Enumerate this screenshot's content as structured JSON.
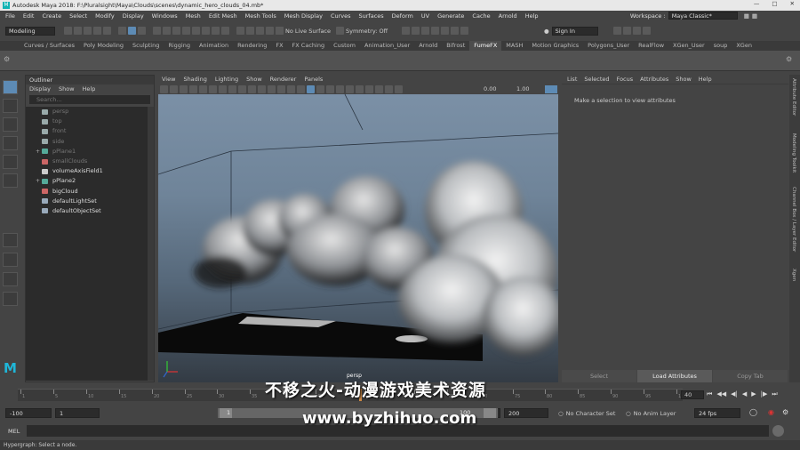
{
  "title_bar": {
    "text": "Autodesk Maya 2018: F:\\Pluralsight\\Maya\\Clouds\\scenes\\dynamic_hero_clouds_04.mb*"
  },
  "menu_bar": {
    "items": [
      "File",
      "Edit",
      "Create",
      "Select",
      "Modify",
      "Display",
      "Windows",
      "Mesh",
      "Edit Mesh",
      "Mesh Tools",
      "Mesh Display",
      "Curves",
      "Surfaces",
      "Deform",
      "UV",
      "Generate",
      "Cache",
      "Arnold",
      "Help"
    ],
    "workspace_label": "Workspace :",
    "workspace_value": "Maya Classic*"
  },
  "status_line": {
    "mode": "Modeling",
    "live_surface": "No Live Surface",
    "symmetry": "Symmetry: Off",
    "sign_in": "Sign In"
  },
  "shelf": {
    "tabs": [
      "Curves / Surfaces",
      "Poly Modeling",
      "Sculpting",
      "Rigging",
      "Animation",
      "Rendering",
      "FX",
      "FX Caching",
      "Custom",
      "Animation_User",
      "Arnold",
      "Bifrost",
      "FumeFX",
      "MASH",
      "Motion Graphics",
      "Polygons_User",
      "RealFlow",
      "XGen_User",
      "soup",
      "XGen"
    ],
    "active_tab": "FumeFX"
  },
  "outliner": {
    "title": "Outliner",
    "menu": [
      "Display",
      "Show",
      "Help"
    ],
    "search_placeholder": "Search...",
    "items": [
      {
        "label": "persp",
        "kind": "camera",
        "dim": true,
        "expandable": false
      },
      {
        "label": "top",
        "kind": "camera",
        "dim": true,
        "expandable": false
      },
      {
        "label": "front",
        "kind": "camera",
        "dim": true,
        "expandable": false
      },
      {
        "label": "side",
        "kind": "camera",
        "dim": true,
        "expandable": false
      },
      {
        "label": "pPlane1",
        "kind": "mesh",
        "dim": true,
        "expandable": true
      },
      {
        "label": "smallClouds",
        "kind": "cloud",
        "dim": true,
        "expandable": false
      },
      {
        "label": "volumeAxisField1",
        "kind": "field",
        "dim": false,
        "expandable": false
      },
      {
        "label": "pPlane2",
        "kind": "mesh",
        "dim": false,
        "expandable": true
      },
      {
        "label": "bigCloud",
        "kind": "cloud",
        "dim": false,
        "expandable": false
      },
      {
        "label": "defaultLightSet",
        "kind": "set",
        "dim": false,
        "expandable": false
      },
      {
        "label": "defaultObjectSet",
        "kind": "set",
        "dim": false,
        "expandable": false
      }
    ]
  },
  "viewport": {
    "menu": [
      "View",
      "Shading",
      "Lighting",
      "Show",
      "Renderer",
      "Panels"
    ],
    "near_value": "0.00",
    "far_value": "1.00",
    "camera_label": "persp"
  },
  "attribute_editor": {
    "menu": [
      "List",
      "Selected",
      "Focus",
      "Attributes",
      "Show",
      "Help"
    ],
    "hint": "Make a selection to view attributes",
    "buttons": [
      "Select",
      "Load Attributes",
      "Copy Tab"
    ],
    "side_tabs": [
      "Attribute Editor",
      "Modeling Toolkit",
      "Channel Box / Layer Editor",
      "Xgen"
    ]
  },
  "time_slider": {
    "tick_labels": [
      "1",
      "5",
      "10",
      "15",
      "20",
      "25",
      "30",
      "35",
      "40",
      "45",
      "50",
      "55",
      "60",
      "65",
      "70",
      "75",
      "80",
      "85",
      "90",
      "95",
      "100"
    ],
    "current_frame": "40"
  },
  "range_slider": {
    "start": "-100",
    "playback_start": "1",
    "range_inner_start": "1",
    "range_inner_end": "100",
    "playback_end": "100",
    "end": "200",
    "character_set": "No Character Set",
    "anim_layer": "No Anim Layer",
    "fps": "24 fps"
  },
  "command_line": {
    "label": "MEL"
  },
  "help_line": {
    "text": "Hypergraph: Select a node."
  },
  "watermark": {
    "line1": "不移之火-动漫游戏美术资源",
    "line2": "www.byzhihuo.com"
  },
  "colors": {
    "selected_tool": "#5d8bb5",
    "panel_bg": "#444444",
    "field_bg": "#2b2b2b"
  }
}
